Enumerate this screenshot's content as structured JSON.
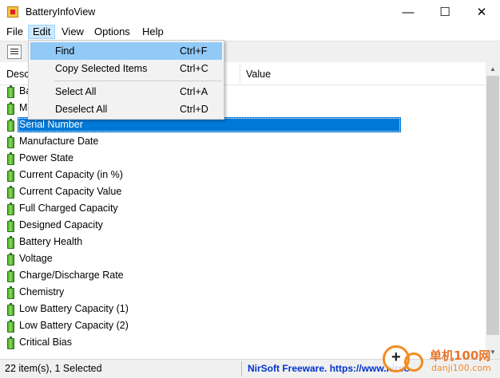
{
  "window": {
    "title": "BatteryInfoView",
    "controls": {
      "minimize": "—",
      "maximize": "☐",
      "close": "✕"
    }
  },
  "menubar": [
    "File",
    "Edit",
    "View",
    "Options",
    "Help"
  ],
  "edit_menu": [
    {
      "label": "Find",
      "shortcut": "Ctrl+F"
    },
    {
      "label": "Copy Selected Items",
      "shortcut": "Ctrl+C"
    },
    {
      "label": "Select All",
      "shortcut": "Ctrl+A"
    },
    {
      "label": "Deselect All",
      "shortcut": "Ctrl+D"
    }
  ],
  "columns": {
    "description": "Desc",
    "value": "Value"
  },
  "rows": [
    "Ba",
    "M",
    "Serial Number",
    "Manufacture Date",
    "Power State",
    "Current Capacity (in %)",
    "Current Capacity Value",
    "Full Charged Capacity",
    "Designed Capacity",
    "Battery Health",
    "Voltage",
    "Charge/Discharge Rate",
    "Chemistry",
    "Low Battery Capacity (1)",
    "Low Battery Capacity (2)",
    "Critical Bias"
  ],
  "status": {
    "items": "22 item(s), 1 Selected",
    "credit": "NirSoft Freeware. https://www.nirso"
  },
  "watermark": {
    "cn": "单机100网",
    "url": "danji100.com"
  }
}
